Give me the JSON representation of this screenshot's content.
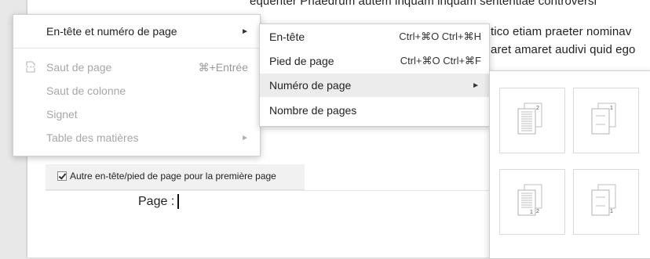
{
  "document": {
    "line1": "equenter Phaedrum autem inquam inquam sententiae controversi",
    "line2": "tico etiam praeter nominav",
    "line3": "aret amaret audivi quid ego"
  },
  "header": {
    "first_page_option": "Autre en-tête/pied de page pour la première page",
    "first_page_checked": true,
    "page_label": "Page :"
  },
  "main_menu": {
    "items": [
      {
        "label": "En-tête et numéro de page",
        "has_submenu": true,
        "enabled": true
      },
      {
        "label": "Saut de page",
        "shortcut": "⌘+Entrée",
        "enabled": false,
        "icon": "page-break-icon"
      },
      {
        "label": "Saut de colonne",
        "enabled": false
      },
      {
        "label": "Signet",
        "enabled": false
      },
      {
        "label": "Table des matières",
        "has_submenu": true,
        "enabled": false
      }
    ]
  },
  "submenu": {
    "items": [
      {
        "label": "En-tête",
        "shortcut": "Ctrl+⌘O Ctrl+⌘H"
      },
      {
        "label": "Pied de page",
        "shortcut": "Ctrl+⌘O Ctrl+⌘F"
      },
      {
        "label": "Numéro de page",
        "has_submenu": true,
        "highlighted": true
      },
      {
        "label": "Nombre de pages"
      }
    ]
  },
  "page_number_panel": {
    "options": [
      {
        "name": "header-with-first-page",
        "number_label": "2",
        "position": "top"
      },
      {
        "name": "header-skip-first-page",
        "number_label": "1",
        "position": "top"
      },
      {
        "name": "footer-with-first-page",
        "number_label": "2",
        "position": "bottom"
      },
      {
        "name": "footer-skip-first-page",
        "number_label": "1",
        "position": "bottom"
      }
    ]
  },
  "arrow_glyph": "►",
  "colors": {
    "highlight": "#ececec",
    "disabled_text": "#a7a7a7"
  }
}
